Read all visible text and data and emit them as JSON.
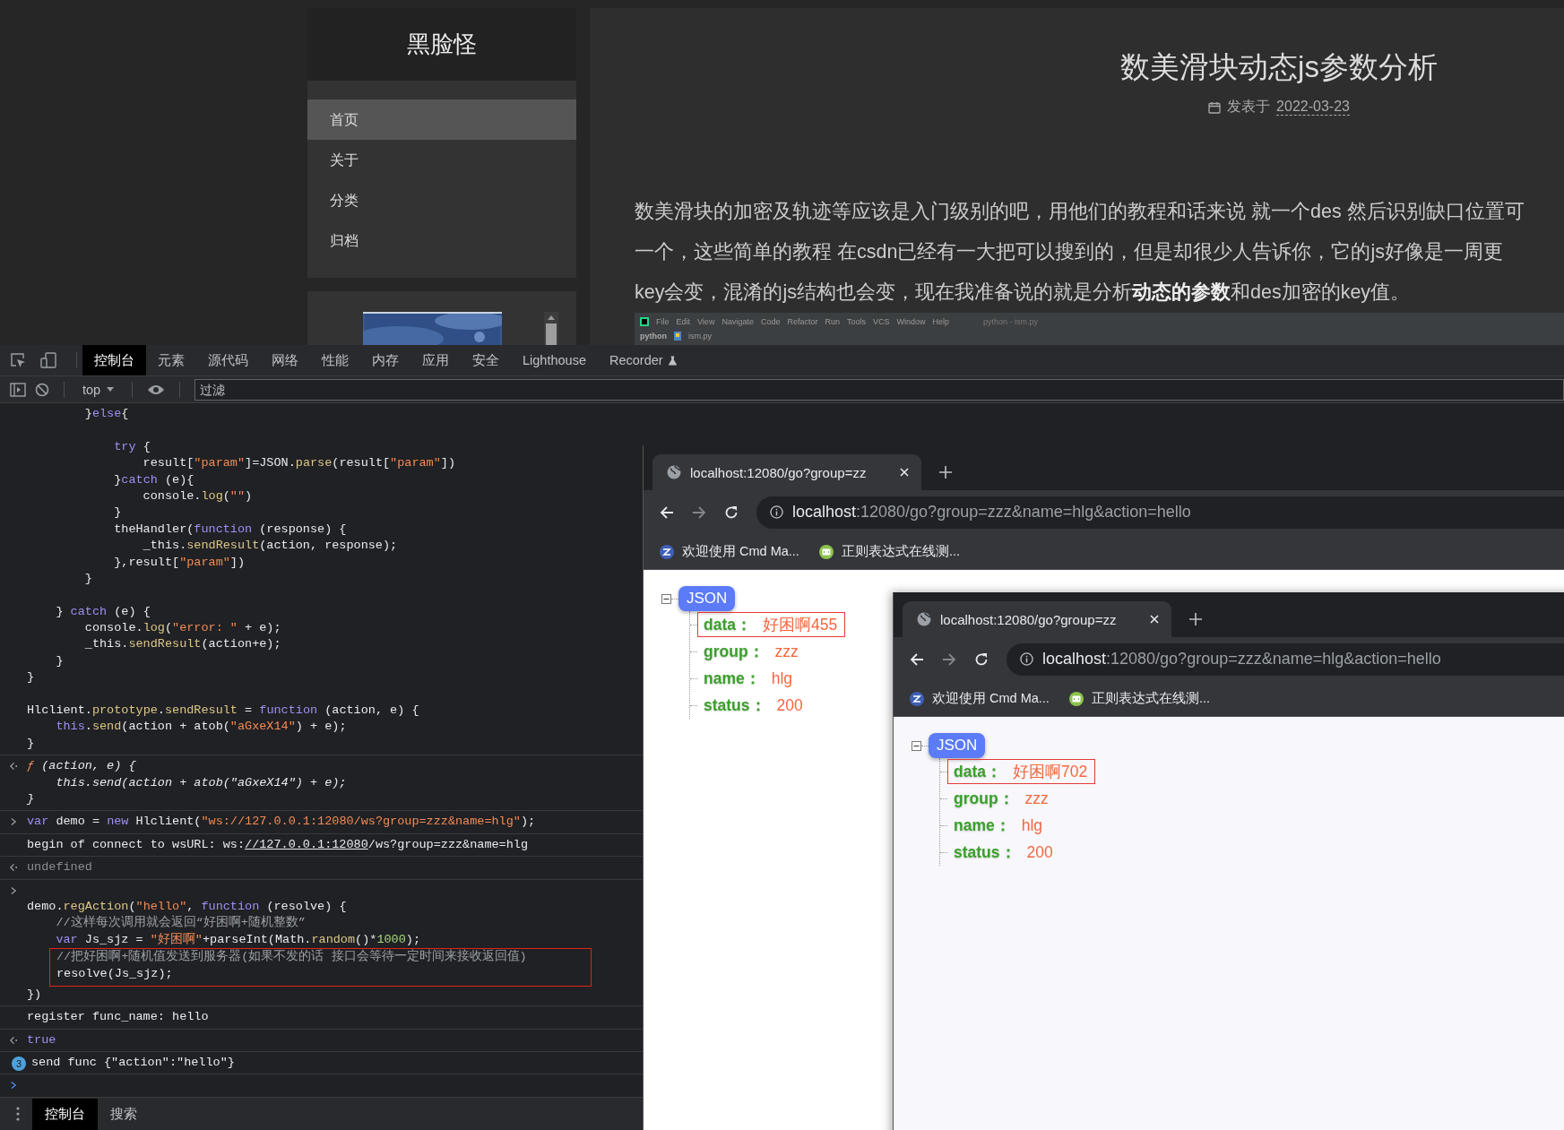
{
  "blog": {
    "site_title": "黑脸怪",
    "nav": [
      {
        "label": "首页",
        "selected": true
      },
      {
        "label": "关于",
        "selected": false
      },
      {
        "label": "分类",
        "selected": false
      },
      {
        "label": "归档",
        "selected": false
      }
    ],
    "article": {
      "title": "数美滑块动态js参数分析",
      "date_label": "发表于",
      "date": "2022-03-23",
      "paragraph_lines": [
        "数美滑块的加密及轨迹等应该是入门级别的吧，用他们的教程和话来说 就一个des 然后识别缺口位置可",
        "一个，这些简单的教程 在csdn已经有一大把可以搜到的，但是却很少人告诉你，它的js好像是一周更",
        "key会变，混淆的js结构也会变，现在我准备说的就是分析**动态的参数**和des加密的key值。"
      ],
      "embedded_ide": {
        "menu": [
          "File",
          "Edit",
          "View",
          "Navigate",
          "Code",
          "Refactor",
          "Run",
          "Tools",
          "VCS",
          "Window",
          "Help"
        ],
        "window_title": "python - ism.py",
        "project": "python",
        "file": "ism.py"
      }
    }
  },
  "devtools": {
    "tabs": [
      {
        "label": "控制台",
        "selected": true,
        "experimental": false
      },
      {
        "label": "元素",
        "selected": false,
        "experimental": false
      },
      {
        "label": "源代码",
        "selected": false,
        "experimental": false
      },
      {
        "label": "网络",
        "selected": false,
        "experimental": false
      },
      {
        "label": "性能",
        "selected": false,
        "experimental": false
      },
      {
        "label": "内存",
        "selected": false,
        "experimental": false
      },
      {
        "label": "应用",
        "selected": false,
        "experimental": false
      },
      {
        "label": "安全",
        "selected": false,
        "experimental": false
      },
      {
        "label": "Lighthouse",
        "selected": false,
        "experimental": false
      },
      {
        "label": "Recorder",
        "selected": false,
        "experimental": true
      }
    ],
    "toolbar": {
      "context": "top",
      "filter_placeholder": "过滤"
    },
    "console": [
      {
        "kind": "continuation",
        "blocks": [
          [
            [
              "        }",
              {
                "kind": "keyword",
                "text": "else"
              },
              "{"
            ]
          ],
          [
            [
              {
                "kind": "keyword",
                "text": "            try"
              },
              " {"
            ],
            [
              "                result[",
              {
                "kind": "string",
                "text": "\"param\""
              },
              "]=JSON.",
              {
                "kind": "method",
                "text": "parse"
              },
              "(result[",
              {
                "kind": "string",
                "text": "\"param\""
              },
              "])"
            ],
            [
              "            }",
              {
                "kind": "keyword",
                "text": "catch"
              },
              " (e){"
            ],
            [
              "                console.",
              {
                "kind": "method",
                "text": "log"
              },
              "(",
              {
                "kind": "string",
                "text": "\"\""
              },
              ")"
            ],
            [
              "            }"
            ],
            [
              "            theHandler(",
              {
                "kind": "keyword",
                "text": "function"
              },
              " (response) {"
            ],
            [
              "                _this.",
              {
                "kind": "method",
                "text": "sendResult"
              },
              "(action, response);"
            ],
            [
              "            },result[",
              {
                "kind": "string",
                "text": "\"param\""
              },
              "])"
            ],
            [
              "        }"
            ]
          ],
          [
            [
              "    } ",
              {
                "kind": "keyword",
                "text": "catch"
              },
              " (e) {"
            ],
            [
              "        console.",
              {
                "kind": "method",
                "text": "log"
              },
              "(",
              {
                "kind": "string",
                "text": "\"error: \""
              },
              " + e);"
            ],
            [
              "        _this.",
              {
                "kind": "method",
                "text": "sendResult"
              },
              "(action+e);"
            ],
            [
              "    }"
            ],
            [
              "}"
            ]
          ],
          [
            [
              "Hlclient.",
              {
                "kind": "method",
                "text": "prototype"
              },
              ".",
              {
                "kind": "method",
                "text": "sendResult"
              },
              " = ",
              {
                "kind": "keyword",
                "text": "function"
              },
              " (action, e) {"
            ],
            [
              {
                "kind": "keyword",
                "text": "    this"
              },
              ".",
              {
                "kind": "method",
                "text": "send"
              },
              "(action + atob(",
              {
                "kind": "string",
                "text": "\"aGxeX14\""
              },
              ") + e);"
            ],
            [
              "}"
            ]
          ]
        ]
      },
      {
        "kind": "result",
        "italic": true,
        "lines": [
          [
            {
              "kind": "signature",
              "text": "ƒ"
            },
            " (action, e) {"
          ],
          [
            "    this.send(action + atob(\"aGxeX14\") + e);"
          ],
          [
            "}"
          ]
        ]
      },
      {
        "kind": "input",
        "lines": [
          [
            {
              "kind": "keyword",
              "text": "var"
            },
            " demo = ",
            {
              "kind": "keyword",
              "text": "new"
            },
            " Hlclient(",
            {
              "kind": "string",
              "text": "\"ws://127.0.0.1:12080/ws?group=zzz&name=hlg\""
            },
            ");"
          ]
        ]
      },
      {
        "kind": "log",
        "lines": [
          [
            "begin of connect to wsURL: ws:",
            {
              "kind": "link",
              "text": "//127.0.0.1:12080"
            },
            "/ws?group=zzz&name=hlg"
          ]
        ]
      },
      {
        "kind": "result",
        "italic": false,
        "lines": [
          [
            {
              "kind": "muted",
              "text": "undefined"
            }
          ]
        ]
      },
      {
        "kind": "input_block",
        "lines": [
          [
            "demo.",
            {
              "kind": "method",
              "text": "regAction"
            },
            "(",
            {
              "kind": "string",
              "text": "\"hello\""
            },
            ", ",
            {
              "kind": "keyword",
              "text": "function"
            },
            " (resolve) {"
          ],
          [
            {
              "kind": "comment",
              "text": "    //这样每次调用就会返回“好困啊+随机整数”"
            }
          ],
          [
            {
              "kind": "keyword",
              "text": "    var"
            },
            " Js_sjz = ",
            {
              "kind": "string",
              "text": "\"好困啊\""
            },
            "+parseInt(Math.",
            {
              "kind": "method",
              "text": "random"
            },
            "()*",
            {
              "kind": "number",
              "text": "1000"
            },
            ");"
          ]
        ],
        "boxed_lines": [
          [
            {
              "kind": "comment",
              "text": "//把好困啊+随机值发送到服务器(如果不发的话 接口会等待一定时间来接收返回值)"
            }
          ],
          [
            "resolve(Js_sjz);"
          ]
        ],
        "lines_after": [
          [
            "})"
          ]
        ]
      },
      {
        "kind": "log",
        "lines": [
          [
            "register func_name: hello"
          ]
        ]
      },
      {
        "kind": "result",
        "italic": false,
        "lines": [
          [
            {
              "kind": "keyword",
              "text": "true"
            }
          ]
        ]
      },
      {
        "kind": "log",
        "count": "3",
        "lines": [
          [
            "send func {\"action\":\"hello\"}"
          ]
        ]
      },
      {
        "kind": "prompt"
      }
    ],
    "drawer_tabs": [
      {
        "label": "控制台",
        "selected": true
      },
      {
        "label": "搜索",
        "selected": false
      }
    ]
  },
  "browser_windows": [
    {
      "tab_title": "localhost:12080/go?group=zz",
      "url_host": "localhost",
      "url_path": ":12080/go?group=zzz&name=hlg&action=hello",
      "bookmarks": [
        {
          "label": "欢迎使用 Cmd Ma...",
          "kind": "cmd"
        },
        {
          "label": "正则表达式在线测...",
          "kind": "regex"
        }
      ],
      "tree": {
        "root": "JSON",
        "expanded": true,
        "rows": [
          {
            "key": "data：",
            "value": "好困啊455",
            "boxed": true
          },
          {
            "key": "group：",
            "value": "zzz",
            "boxed": false
          },
          {
            "key": "name：",
            "value": "hlg",
            "boxed": false
          },
          {
            "key": "status：",
            "value": "200",
            "boxed": false
          }
        ]
      }
    },
    {
      "tab_title": "localhost:12080/go?group=zz",
      "url_host": "localhost",
      "url_path": ":12080/go?group=zzz&name=hlg&action=hello",
      "bookmarks": [
        {
          "label": "欢迎使用 Cmd Ma...",
          "kind": "cmd"
        },
        {
          "label": "正则表达式在线测...",
          "kind": "regex"
        }
      ],
      "tree": {
        "root": "JSON",
        "expanded": true,
        "rows": [
          {
            "key": "data：",
            "value": "好困啊702",
            "boxed": true
          },
          {
            "key": "group：",
            "value": "zzz",
            "boxed": false
          },
          {
            "key": "name：",
            "value": "hlg",
            "boxed": false
          },
          {
            "key": "status：",
            "value": "200",
            "boxed": false
          }
        ]
      }
    }
  ]
}
